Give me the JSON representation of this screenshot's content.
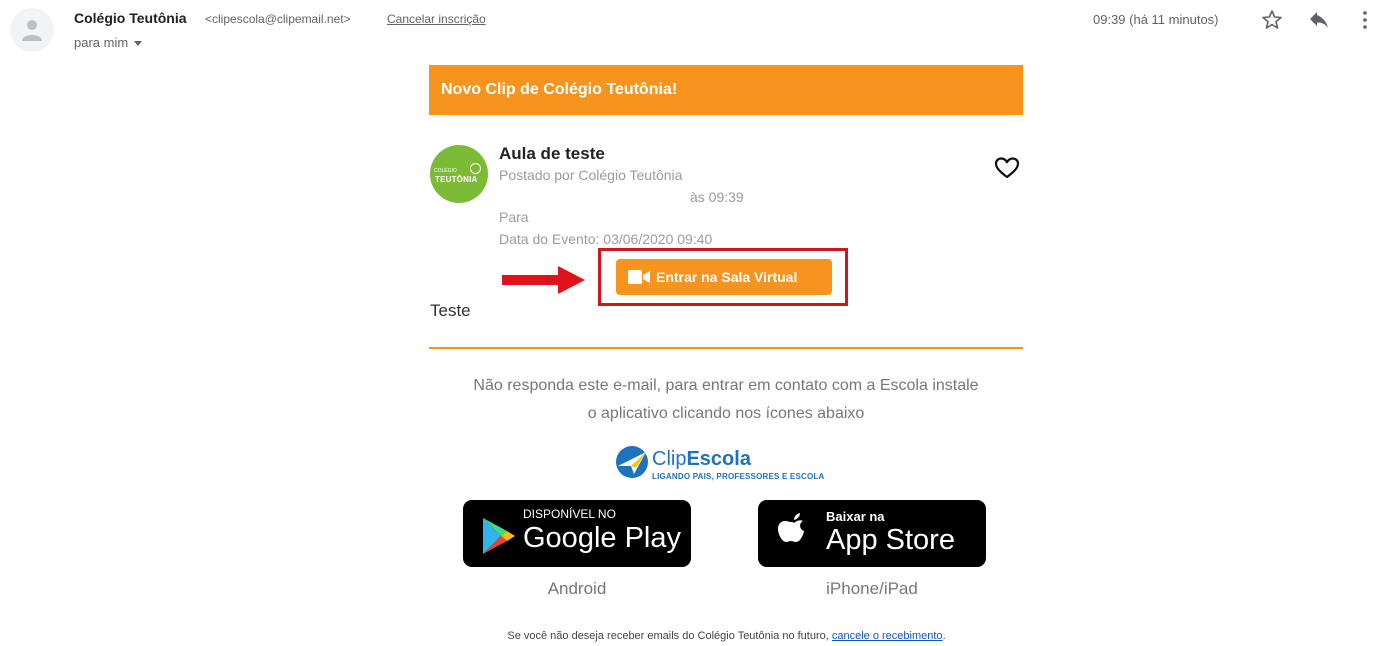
{
  "header": {
    "sender_name": "Colégio Teutônia",
    "sender_email": "<clipescola@clipemail.net>",
    "unsubscribe": "Cancelar inscrição",
    "recipient": "para mim",
    "time": "09:39 (há 11 minutos)",
    "icons": [
      "avatar-icon",
      "star-icon",
      "reply-icon",
      "more-vertical-icon"
    ]
  },
  "email": {
    "banner_title": "Novo Clip de Colégio Teutônia!",
    "logo_line1": "COLÉGIO",
    "logo_line2": "TEUTÔNIA",
    "post_title": "Aula de teste",
    "posted_by": "Postado por Colégio Teutônia",
    "posted_time": "às 09:39",
    "para": "Para",
    "event_date": "Data do Evento: 03/06/2020 09:40",
    "join_button": "Entrar na Sala Virtual",
    "body_text": "Teste",
    "notice_line1": "Não responda este e-mail, para entrar em contato com a Escola instale",
    "notice_line2": "o aplicativo clicando nos ícones abaixo",
    "clip_logo_part1": "Clip",
    "clip_logo_part2": "Escola",
    "clip_tagline": "LIGANDO PAIS, PROFESSORES E ESCOLA",
    "google_play_small": "DISPONÍVEL NO",
    "google_play_big": "Google Play",
    "google_play_label": "Android",
    "app_store_small": "Baixar na",
    "app_store_big": "App Store",
    "app_store_label": "iPhone/iPad",
    "footer_text": "Se você não deseja receber emails do Colégio Teutônia no futuro,",
    "footer_link": "cancele o recebimento",
    "footer_end": "."
  },
  "colors": {
    "accent_orange": "#f7941d",
    "highlight_red": "#d0161d",
    "logo_green": "#7cbb36",
    "brand_blue": "#1e73be"
  }
}
